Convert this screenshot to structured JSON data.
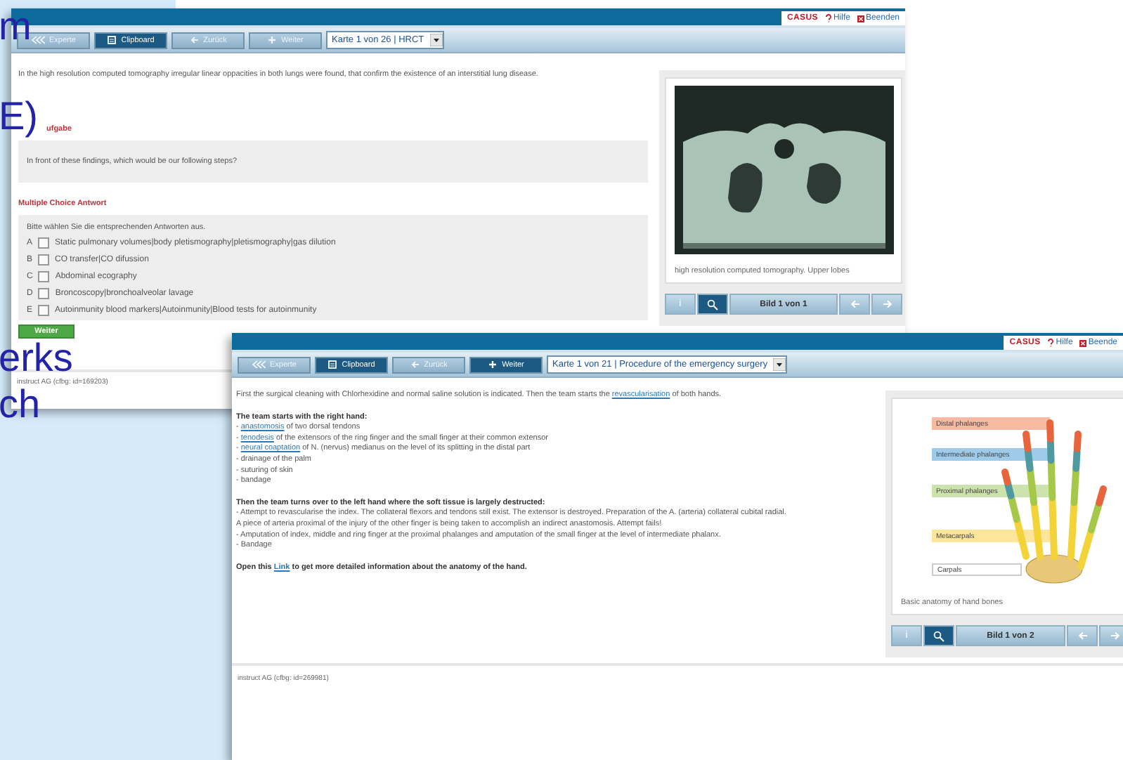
{
  "slide_fragments": [
    "m",
    "E)",
    "erks",
    "ch"
  ],
  "windows": [
    {
      "brand": "CASUS",
      "help": "Hilfe",
      "quit": "Beenden",
      "toolbar": [
        {
          "kind": "expert",
          "label": "Experte",
          "active": false
        },
        {
          "kind": "clipboard",
          "label": "Clipboard",
          "active": true
        },
        {
          "kind": "back",
          "label": "Zurück",
          "active": false
        },
        {
          "kind": "forward",
          "label": "Weiter",
          "active": false
        }
      ],
      "card_select": "Karte 1 von 26 | HRCT",
      "content": [
        {
          "kind": "para",
          "lines": [
            {
              "bold": false,
              "parts": [
                {
                  "text": "In the high resolution computed tomography irregular linear oppacities in both lungs were found, that confirm the existence of an interstitial lung disease.",
                  "link": false
                }
              ]
            }
          ]
        },
        {
          "kind": "heading",
          "text": "ufgabe"
        },
        {
          "kind": "question",
          "text": "In front of these findings, which would be our following steps?"
        },
        {
          "kind": "heading",
          "text": "Multiple Choice Antwort"
        },
        {
          "kind": "choices",
          "intro": "Bitte wählen Sie die entsprechenden Antworten aus.",
          "options": [
            {
              "letter": "A",
              "text": "Static pulmonary volumes|body pletismography|pletismography|gas dilution",
              "checked": false
            },
            {
              "letter": "B",
              "text": "CO transfer|CO difussion",
              "checked": false
            },
            {
              "letter": "C",
              "text": "Abdominal ecography",
              "checked": false
            },
            {
              "letter": "D",
              "text": "Broncoscopy|bronchoalveolar lavage",
              "checked": false
            },
            {
              "letter": "E",
              "text": "Autoinmunity blood markers|Autoinmunity|Blood tests for autoinmunity",
              "checked": false
            }
          ]
        },
        {
          "kind": "submit",
          "label": "Weiter"
        }
      ],
      "media": {
        "kind": "ct",
        "caption": "high resolution computed tomography. Upper lobes",
        "info": "i",
        "counter": "Bild 1 von 1"
      },
      "footer": "instruct AG (cfbg: id=169203)"
    },
    {
      "brand": "CASUS",
      "help": "Hilfe",
      "quit": "Beende",
      "toolbar": [
        {
          "kind": "expert",
          "label": "Experte",
          "active": false
        },
        {
          "kind": "clipboard",
          "label": "Clipboard",
          "active": true
        },
        {
          "kind": "back",
          "label": "Zurück",
          "active": false
        },
        {
          "kind": "forward",
          "label": "Weiter",
          "active": true
        }
      ],
      "card_select": "Karte 1 von 21 | Procedure of the emergency surgery",
      "content": [
        {
          "kind": "para",
          "lines": [
            {
              "bold": false,
              "parts": [
                {
                  "text": "First the surgical cleaning with Chlorhexidine and normal saline solution is indicated. Then the team starts the ",
                  "link": false
                },
                {
                  "text": "revascularisation",
                  "link": true
                },
                {
                  "text": " of both hands.",
                  "link": false
                }
              ]
            }
          ]
        },
        {
          "kind": "para",
          "lines": [
            {
              "bold": true,
              "parts": [
                {
                  "text": "The team starts with the right hand:",
                  "link": false
                }
              ]
            },
            {
              "bold": false,
              "parts": [
                {
                  "text": "- ",
                  "link": false
                },
                {
                  "text": "anastomosis",
                  "link": true
                },
                {
                  "text": " of two dorsal tendons",
                  "link": false
                }
              ]
            },
            {
              "bold": false,
              "parts": [
                {
                  "text": "- ",
                  "link": false
                },
                {
                  "text": "tenodesis",
                  "link": true
                },
                {
                  "text": " of the extensors of the ring finger and the small finger at their common extensor",
                  "link": false
                }
              ]
            },
            {
              "bold": false,
              "parts": [
                {
                  "text": "- ",
                  "link": false
                },
                {
                  "text": "neural coaptation",
                  "link": true
                },
                {
                  "text": " of N. (nervus) medianus on the level of its splitting in the distal part",
                  "link": false
                }
              ]
            },
            {
              "bold": false,
              "parts": [
                {
                  "text": "- drainage of the palm",
                  "link": false
                }
              ]
            },
            {
              "bold": false,
              "parts": [
                {
                  "text": "- suturing of skin",
                  "link": false
                }
              ]
            },
            {
              "bold": false,
              "parts": [
                {
                  "text": "- bandage",
                  "link": false
                }
              ]
            }
          ]
        },
        {
          "kind": "para",
          "lines": [
            {
              "bold": true,
              "parts": [
                {
                  "text": "Then the team turns over to the left hand where the soft tissue is largely destructed:",
                  "link": false
                }
              ]
            },
            {
              "bold": false,
              "parts": [
                {
                  "text": "- Attempt to revascularise the index. The collateral flexors and tendons still exist. The extensor is destroyed. Preparation of the A. (arteria) collateral cubital radial.",
                  "link": false
                }
              ]
            },
            {
              "bold": false,
              "parts": [
                {
                  "text": "A piece of arteria proximal of the injury of the other finger is being taken to accomplish an indirect anastomosis. Attempt fails!",
                  "link": false
                }
              ]
            },
            {
              "bold": false,
              "parts": [
                {
                  "text": "- Amputation of index, middle and ring finger at the proximal phalanges and amputation of the small finger at the level of intermediate phalanx.",
                  "link": false
                }
              ]
            },
            {
              "bold": false,
              "parts": [
                {
                  "text": "- Bandage",
                  "link": false
                }
              ]
            }
          ]
        },
        {
          "kind": "para",
          "lines": [
            {
              "bold": true,
              "parts": [
                {
                  "text": "Open this ",
                  "link": false
                },
                {
                  "text": "Link",
                  "link": true
                },
                {
                  "text": " to get more detailed information about the anatomy of the hand.",
                  "link": false
                }
              ]
            }
          ]
        }
      ],
      "media": {
        "kind": "hand",
        "labels": [
          {
            "text": "Distal phalanges",
            "color": "#f6b9a1"
          },
          {
            "text": "Intermediate phalanges",
            "color": "#9fcbeb"
          },
          {
            "text": "Proximal phalanges",
            "color": "#cde3ad"
          },
          {
            "text": "Metacarpals",
            "color": "#fde59b"
          },
          {
            "text": "Carpals",
            "color": "#ffffff"
          }
        ],
        "caption": "Basic anatomy of hand bones",
        "info": "i",
        "counter": "Bild 1 von 2"
      },
      "footer": "instruct AG (cfbg: id=269981)"
    }
  ]
}
